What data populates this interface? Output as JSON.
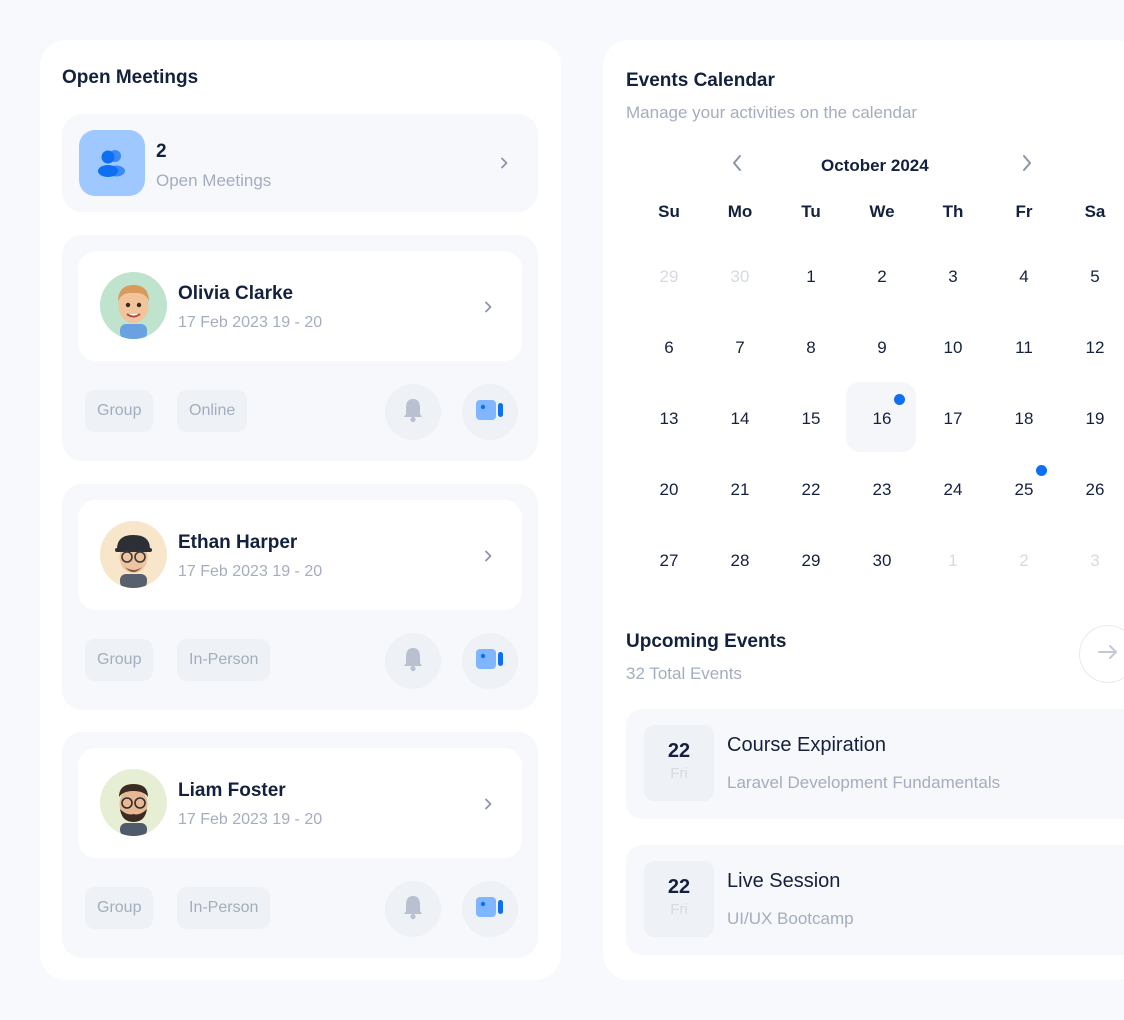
{
  "open_meetings": {
    "title": "Open Meetings",
    "count": "2",
    "count_label": "Open Meetings",
    "meetings": [
      {
        "name": "Olivia Clarke",
        "date": "17 Feb 2023 19 - 20",
        "tags": [
          "Group",
          "Online"
        ],
        "avatar_bg": "#bfe3cc"
      },
      {
        "name": "Ethan Harper",
        "date": "17 Feb 2023 19 - 20",
        "tags": [
          "Group",
          "In-Person"
        ],
        "avatar_bg": "#f7e6c9"
      },
      {
        "name": "Liam Foster",
        "date": "17 Feb 2023 19 - 20",
        "tags": [
          "Group",
          "In-Person"
        ],
        "avatar_bg": "#e6efd4"
      }
    ]
  },
  "calendar": {
    "title": "Events Calendar",
    "subtitle": "Manage your activities on the calendar",
    "month": "October 2024",
    "weekdays": [
      "Su",
      "Mo",
      "Tu",
      "We",
      "Th",
      "Fr",
      "Sa"
    ],
    "weeks": [
      [
        "29",
        "30",
        "1",
        "2",
        "3",
        "4",
        "5"
      ],
      [
        "6",
        "7",
        "8",
        "9",
        "10",
        "11",
        "12"
      ],
      [
        "13",
        "14",
        "15",
        "16",
        "17",
        "18",
        "19"
      ],
      [
        "20",
        "21",
        "22",
        "23",
        "24",
        "25",
        "26"
      ],
      [
        "27",
        "28",
        "29",
        "30",
        "1",
        "2",
        "3"
      ]
    ],
    "selected_day": "16",
    "event_days": [
      "16",
      "25"
    ]
  },
  "upcoming": {
    "title": "Upcoming Events",
    "total": "32 Total Events",
    "events": [
      {
        "day": "22",
        "weekday": "Fri",
        "title": "Course Expiration",
        "subtitle": "Laravel Development Fundamentals"
      },
      {
        "day": "22",
        "weekday": "Fri",
        "title": "Live Session",
        "subtitle": "UI/UX Bootcamp"
      }
    ]
  },
  "colors": {
    "accent": "#0e6ff2",
    "icon_tile": "#9ec8ff",
    "muted_text": "#a4adbf",
    "title_text": "#14213d"
  }
}
